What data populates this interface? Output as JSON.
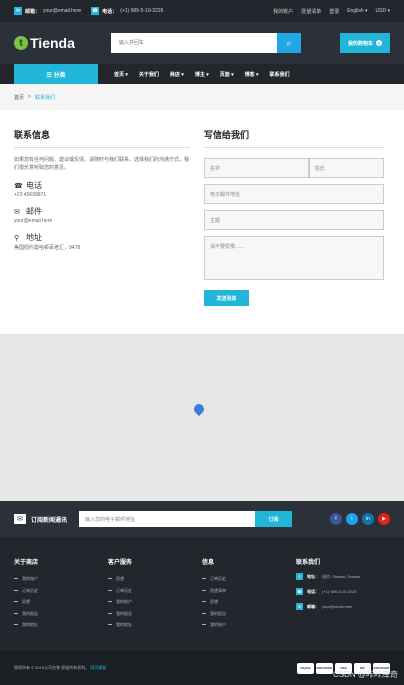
{
  "topbar": {
    "email_label": "邮箱：",
    "email_value": "your@email.here",
    "phone_label": "电话：",
    "phone_value": "(+1) 989-5-10-3226",
    "links": [
      "我的账户",
      "愿望清单",
      "登录",
      "English ▾",
      "USD ▾"
    ]
  },
  "header": {
    "logo": "Tienda",
    "search_placeholder": "输入并回车",
    "cart_label": "我的购物车",
    "cart_count": "0"
  },
  "nav": {
    "category_label": "☰  分类",
    "items": [
      "首页 ▾",
      "关于我们",
      "商店 ▾",
      "博主 ▾",
      "页面 ▾",
      "博客 ▾",
      "联系我们"
    ]
  },
  "breadcrumb": {
    "home": "首页",
    "sep": ">",
    "current": "联系我们"
  },
  "contact_info": {
    "title": "联系信息",
    "desc": "如果您有任何问题、建议或反馈，请随时与我们联系。选择我们的沟通方式，我们很乐意听取您的意见。",
    "phone_title": "电话",
    "phone_value": "+23 45699871",
    "email_title": "邮件",
    "email_value": "your@email.here",
    "address_title": "地址",
    "address_value": "美国纽约曼哈顿百老汇，9478"
  },
  "form": {
    "title": "写信给我们",
    "first_name": "名字",
    "last_name": "姓氏",
    "email": "电子邮件地址",
    "subject": "主题",
    "message": "请不要犹豫……",
    "submit": "发送消息"
  },
  "newsletter": {
    "title": "订阅新闻通讯",
    "placeholder": "输入您的电子邮件地址",
    "button": "订阅"
  },
  "footer": {
    "col1": {
      "title": "关于商店",
      "items": [
        "我的账户",
        "订单历史",
        "愿望",
        "我的报告",
        "我的地址"
      ]
    },
    "col2": {
      "title": "客户服务",
      "items": [
        "愿望",
        "订单历史",
        "我的账户",
        "我的报告",
        "我的地址"
      ]
    },
    "col3": {
      "title": "信息",
      "items": [
        "订单历史",
        "愿望清单",
        "愿望",
        "我的报告",
        "我的账户"
      ]
    },
    "col4": {
      "title": "联系我们",
      "address_label": "地址：",
      "address_value": "纽约, Ottawa, Ontario",
      "phone_label": "电话：",
      "phone_value": "(+1) 989-5-10-3226",
      "email_label": "邮箱：",
      "email_value": "your@email.here"
    }
  },
  "bottom": {
    "copyright": "版权所有 © 2019公司名称 保留所有权利。",
    "link": "网页模板",
    "payments": [
      "PayPal",
      "DISCOVER",
      "VISA",
      "MC",
      "DISCOVER"
    ],
    "watermark": "CSDN @咔咔库奇"
  },
  "colors": {
    "accent": "#21b6d7",
    "dark": "#23272d",
    "header": "#2c3139",
    "logo_green": "#7cc242"
  }
}
